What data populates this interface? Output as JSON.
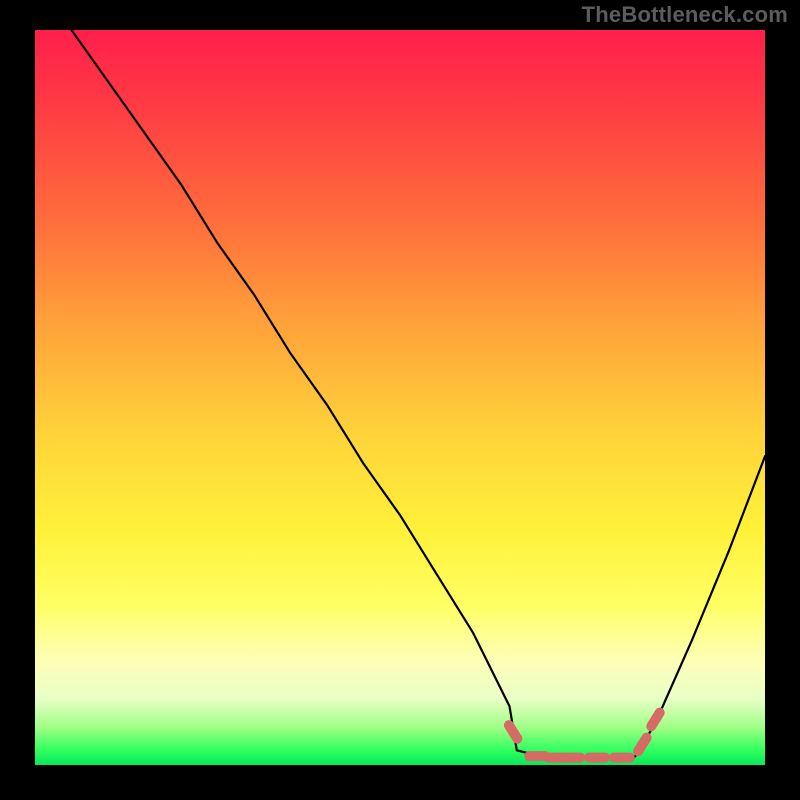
{
  "watermark": "TheBottleneck.com",
  "colors": {
    "page_bg": "#000000",
    "gradient_top": "#ff1f4b",
    "gradient_bottom": "#06e85a",
    "curve": "#000000",
    "markers": "#d66a65",
    "watermark": "#5c5c5c"
  },
  "chart_data": {
    "type": "line",
    "title": "",
    "xlabel": "",
    "ylabel": "",
    "xlim": [
      0,
      100
    ],
    "ylim": [
      0,
      100
    ],
    "grid": false,
    "legend": false,
    "note": "V-shaped bottleneck curve over a red-to-green vertical gradient. Y≈100 means high bottleneck (top, red); y≈0 means no bottleneck (bottom, green). Minimum plateau roughly between x≈66 and x≈83.",
    "series": [
      {
        "name": "bottleneck-curve",
        "x": [
          5,
          10,
          15,
          20,
          25,
          30,
          35,
          40,
          45,
          50,
          55,
          60,
          65,
          66,
          70,
          74,
          78,
          82,
          83,
          86,
          90,
          95,
          100
        ],
        "values": [
          100,
          93,
          86,
          79,
          71,
          64,
          56,
          49,
          41,
          34,
          26,
          18,
          8,
          2,
          1,
          1,
          1,
          1,
          2,
          8,
          17,
          29,
          42
        ]
      }
    ],
    "markers": [
      {
        "shape": "lozenge",
        "approx_x": 65.5,
        "approx_y": 4.5
      },
      {
        "shape": "lozenge",
        "approx_x": 68.8,
        "approx_y": 1.2
      },
      {
        "shape": "lozenge",
        "approx_x": 71.4,
        "approx_y": 1.0
      },
      {
        "shape": "lozenge",
        "approx_x": 73.6,
        "approx_y": 1.0
      },
      {
        "shape": "lozenge",
        "approx_x": 77.0,
        "approx_y": 1.0
      },
      {
        "shape": "lozenge",
        "approx_x": 80.4,
        "approx_y": 1.0
      },
      {
        "shape": "lozenge",
        "approx_x": 83.2,
        "approx_y": 2.8
      },
      {
        "shape": "lozenge",
        "approx_x": 85.0,
        "approx_y": 6.2
      }
    ]
  }
}
